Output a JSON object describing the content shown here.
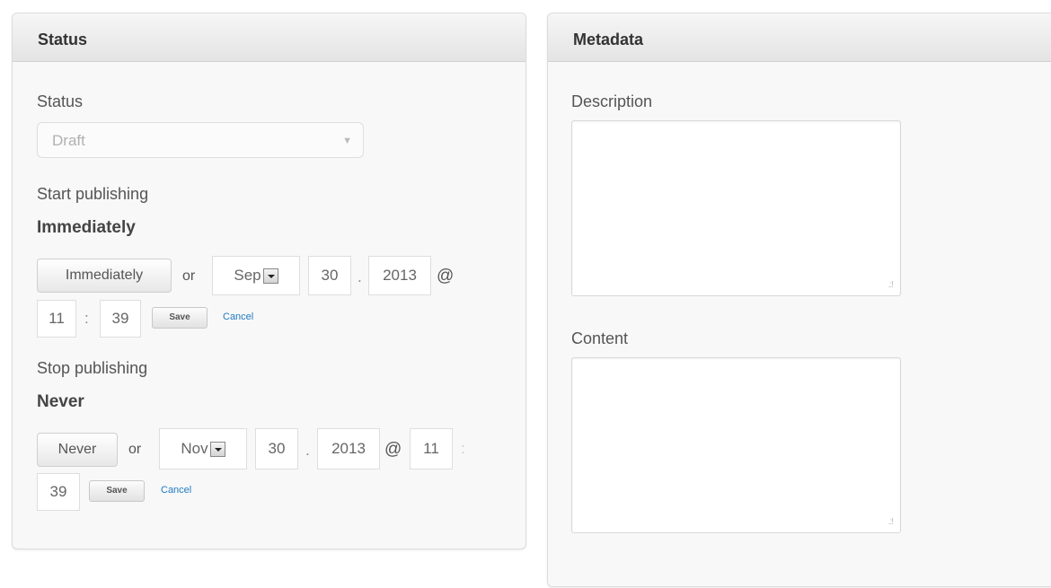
{
  "status_panel": {
    "title": "Status",
    "status_label": "Status",
    "status_value": "Draft",
    "start": {
      "label": "Start publishing",
      "value": "Immediately",
      "button": "Immediately",
      "or": "or",
      "month": "Sep",
      "day": "30",
      "dot": ".",
      "year": "2013",
      "at": "@",
      "hour": "11",
      "colon": ":",
      "minute": "39",
      "save": "Save",
      "cancel": "Cancel"
    },
    "stop": {
      "label": "Stop publishing",
      "value": "Never",
      "button": "Never",
      "or": "or",
      "month": "Nov",
      "day": "30",
      "dot": ".",
      "year": "2013",
      "at": "@",
      "hour": "11",
      "colon": ":",
      "minute": "39",
      "save": "Save",
      "cancel": "Cancel"
    }
  },
  "metadata_panel": {
    "title": "Metadata",
    "description_label": "Description",
    "description_value": "",
    "content_label": "Content",
    "content_value": ""
  },
  "colors": {
    "link": "#1f7bc0",
    "header_bg": "#e4e4e4",
    "panel_bg": "#f8f8f8"
  },
  "icons": {
    "select_arrow": "chevron-down-icon",
    "month_dropdown": "dropdown-arrow-icon",
    "resize": "resize-grip-icon"
  }
}
